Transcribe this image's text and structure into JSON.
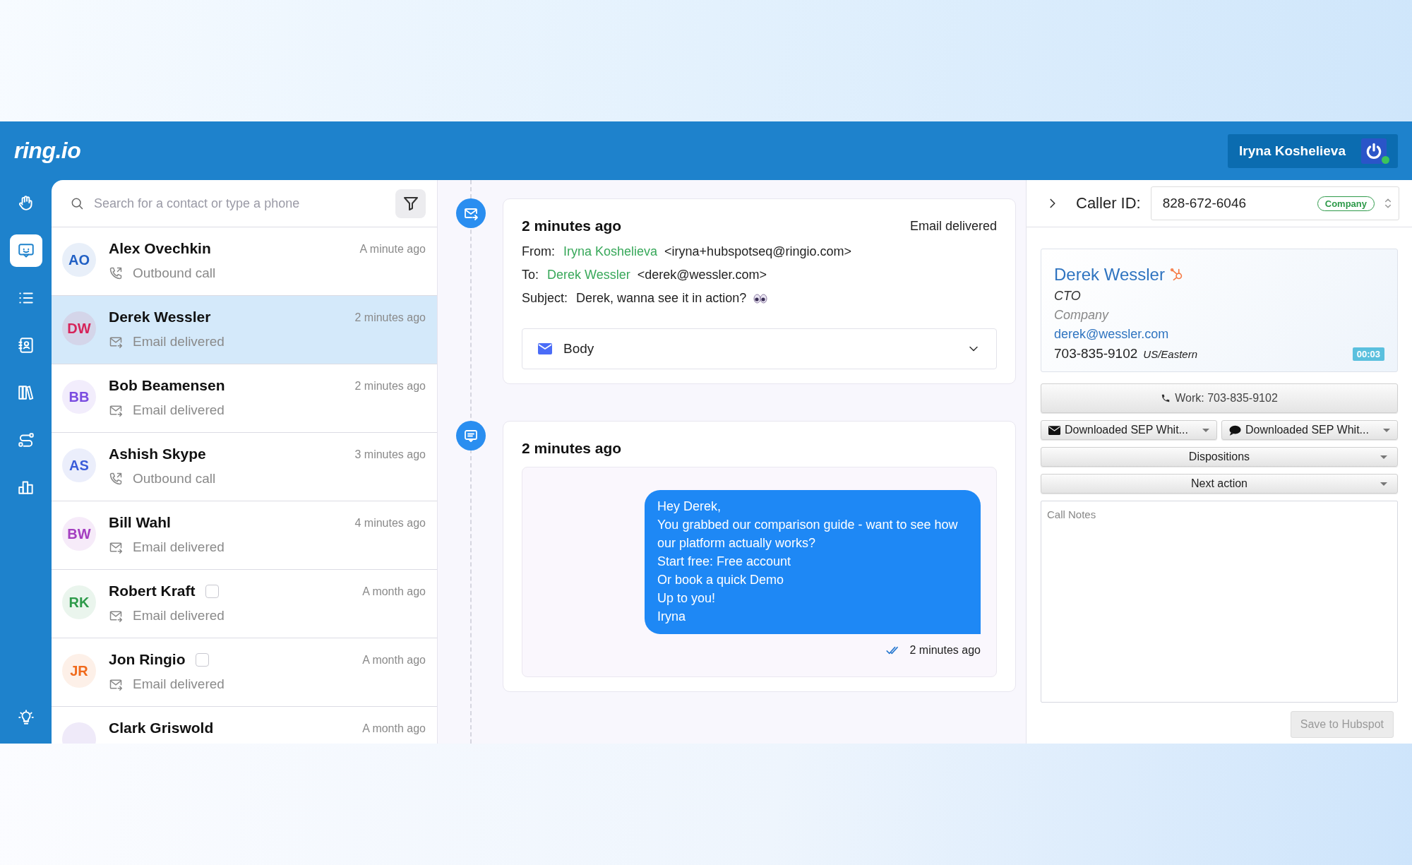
{
  "header": {
    "logo": "ring.io",
    "user": {
      "name": "Iryna Koshelieva",
      "online": true
    }
  },
  "nav": [
    {
      "selected": false
    },
    {
      "selected": true
    },
    {
      "selected": false
    },
    {
      "selected": false
    },
    {
      "selected": false
    },
    {
      "selected": false
    },
    {
      "selected": false
    }
  ],
  "search": {
    "placeholder": "Search for a contact or type a phone"
  },
  "contacts": [
    {
      "initials": "AO",
      "color": "#2160c4",
      "name": "Alex Ovechkin",
      "time": "A minute ago",
      "kind": "call",
      "activity": "Outbound call",
      "selected": false
    },
    {
      "initials": "DW",
      "color": "#d6245a",
      "name": "Derek Wessler",
      "time": "2 minutes ago",
      "kind": "email",
      "activity": "Email delivered",
      "selected": true
    },
    {
      "initials": "BB",
      "color": "#7b4de0",
      "name": "Bob Beamensen",
      "time": "2 minutes ago",
      "kind": "email",
      "activity": "Email delivered",
      "selected": false
    },
    {
      "initials": "AS",
      "color": "#3a5bd9",
      "name": "Ashish Skype",
      "time": "3 minutes ago",
      "kind": "call",
      "activity": "Outbound call",
      "selected": false
    },
    {
      "initials": "BW",
      "color": "#a43fc0",
      "name": "Bill Wahl",
      "time": "4 minutes ago",
      "kind": "email",
      "activity": "Email delivered",
      "selected": false
    },
    {
      "initials": "RK",
      "color": "#2e9a4a",
      "name": "Robert Kraft",
      "checkbox": {
        "checked": false
      },
      "time": "A month ago",
      "kind": "email",
      "activity": "Email delivered",
      "selected": false
    },
    {
      "initials": "JR",
      "color": "#f06a1c",
      "name": "Jon Ringio",
      "checkbox": {
        "checked": false
      },
      "time": "A month ago",
      "kind": "email",
      "activity": "Email delivered",
      "selected": false
    },
    {
      "name": "Clark Griswold",
      "time": "A month ago",
      "selected": false
    }
  ],
  "timeline": [
    {
      "kind": "email",
      "time": "2 minutes ago",
      "status": "Email delivered",
      "from": {
        "label": "From:",
        "name": "Iryna Koshelieva",
        "address": "<iryna+hubspotseq@ringio.com>"
      },
      "to": {
        "label": "To:",
        "name": "Derek Wessler",
        "address": "<derek@wessler.com>"
      },
      "subject": {
        "label": "Subject:",
        "text": "Derek, wanna see it in action?"
      },
      "body": {
        "label": "Body",
        "expanded": false
      }
    },
    {
      "kind": "message",
      "time": "2 minutes ago",
      "text": "Hey Derek,\nYou grabbed our comparison guide - want to see how our platform actually works?\nStart free: Free account\nOr book a quick Demo\nUp to you!\nIryna",
      "sent": "2 minutes ago"
    }
  ],
  "caller_id": {
    "label": "Caller ID:",
    "value": "828-672-6046",
    "badge": "Company"
  },
  "contact_card": {
    "name": "Derek Wessler",
    "title": "CTO",
    "company": "Company",
    "email": "derek@wessler.com",
    "phone": "703-835-9102",
    "timezone": "US/Eastern",
    "timer": "00:03"
  },
  "work_button": "Work: 703-835-9102",
  "template_dropdowns": [
    {
      "kind": "email",
      "label": "Downloaded SEP Whit..."
    },
    {
      "kind": "sms",
      "label": "Downloaded SEP Whit..."
    }
  ],
  "dropdowns": [
    "Dispositions",
    "Next action"
  ],
  "notes": {
    "placeholder": "Call Notes"
  },
  "save_button": {
    "label": "Save to Hubspot",
    "disabled": true
  }
}
